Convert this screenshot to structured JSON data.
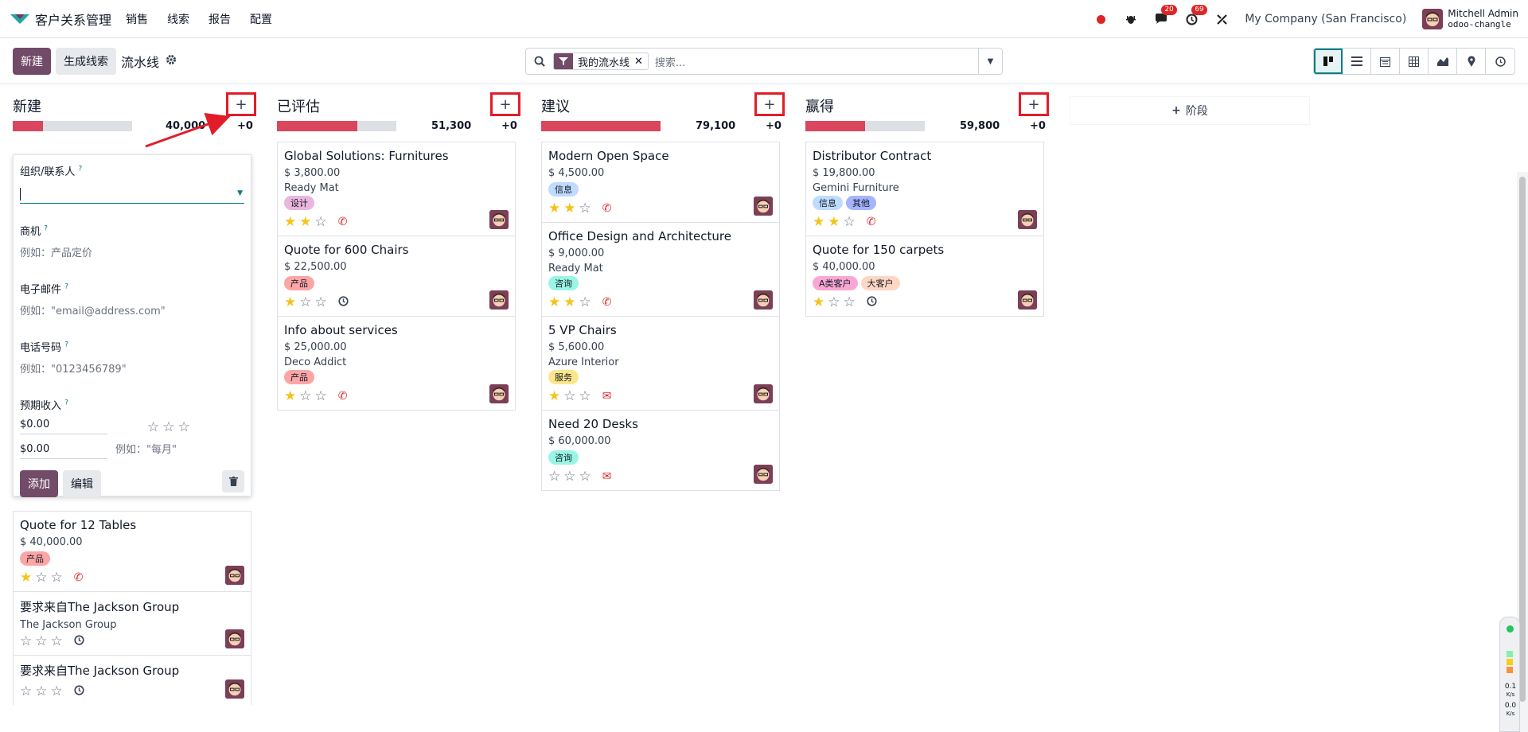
{
  "app": {
    "name": "客户关系管理"
  },
  "menu": [
    "销售",
    "线索",
    "报告",
    "配置"
  ],
  "systray": {
    "messages_count": "20",
    "activities_count": "69",
    "company": "My Company (San Francisco)",
    "user_name": "Mitchell Admin",
    "user_db": "odoo-changle"
  },
  "control": {
    "new_label": "新建",
    "generate_label": "生成线索",
    "breadcrumb": "流水线",
    "facet": "我的流水线",
    "search_placeholder": "搜索..."
  },
  "columns": [
    {
      "title": "新建",
      "total": "40,000",
      "plus": "+0",
      "progress": 0.25
    },
    {
      "title": "已评估",
      "total": "51,300",
      "plus": "+0",
      "progress": 0.67
    },
    {
      "title": "建议",
      "total": "79,100",
      "plus": "+0",
      "progress": 1.0
    },
    {
      "title": "嬴得",
      "total": "59,800",
      "plus": "+0",
      "progress": 0.5
    }
  ],
  "quick_create": {
    "contact_label": "组织/联系人",
    "opportunity_label": "商机",
    "opportunity_placeholder": "例如：产品定价",
    "email_label": "电子邮件",
    "email_placeholder": "例如：\"email@address.com\"",
    "phone_label": "电话号码",
    "phone_placeholder": "例如：\"0123456789\"",
    "revenue_label": "预期收入",
    "revenue_value": "$0.00",
    "recurring_value": "$0.00",
    "recurring_hint": "例如：\"每月\"",
    "add_label": "添加",
    "edit_label": "编辑",
    "help_mark": "?"
  },
  "cards_new": [
    {
      "title": "Quote for 12 Tables",
      "amount": "$ 40,000.00",
      "company": "",
      "tags": [
        {
          "label": "产品",
          "color": "#fca5a5"
        }
      ],
      "stars": 1,
      "activity": "phone"
    },
    {
      "title": "要求来自The Jackson Group",
      "amount": "",
      "company": "The Jackson Group",
      "tags": [],
      "stars": 0,
      "activity": "clock"
    },
    {
      "title": "要求来自The Jackson Group",
      "amount": "",
      "company": "",
      "tags": [],
      "stars": 0,
      "activity": "clock"
    }
  ],
  "cards_qualified": [
    {
      "title": "Global Solutions: Furnitures",
      "amount": "$ 3,800.00",
      "company": "Ready Mat",
      "tags": [
        {
          "label": "设计",
          "color": "#e9b7de"
        }
      ],
      "stars": 2,
      "activity": "phone"
    },
    {
      "title": "Quote for 600 Chairs",
      "amount": "$ 22,500.00",
      "company": "",
      "tags": [
        {
          "label": "产品",
          "color": "#fca5a5"
        }
      ],
      "stars": 1,
      "activity": "clock"
    },
    {
      "title": "Info about services",
      "amount": "$ 25,000.00",
      "company": "Deco Addict",
      "tags": [
        {
          "label": "产品",
          "color": "#fca5a5"
        }
      ],
      "stars": 1,
      "activity": "phone"
    }
  ],
  "cards_proposition": [
    {
      "title": "Modern Open Space",
      "amount": "$ 4,500.00",
      "company": "",
      "tags": [
        {
          "label": "信息",
          "color": "#bfdbfe"
        }
      ],
      "stars": 2,
      "activity": "phone"
    },
    {
      "title": "Office Design and Architecture",
      "amount": "$ 9,000.00",
      "company": "Ready Mat",
      "tags": [
        {
          "label": "咨询",
          "color": "#99f6e4"
        }
      ],
      "stars": 2,
      "activity": "phone"
    },
    {
      "title": "5 VP Chairs",
      "amount": "$ 5,600.00",
      "company": "Azure Interior",
      "tags": [
        {
          "label": "服务",
          "color": "#fde68a"
        }
      ],
      "stars": 1,
      "activity": "mail"
    },
    {
      "title": "Need 20 Desks",
      "amount": "$ 60,000.00",
      "company": "",
      "tags": [
        {
          "label": "咨询",
          "color": "#99f6e4"
        }
      ],
      "stars": 0,
      "activity": "mail"
    }
  ],
  "cards_won": [
    {
      "title": "Distributor Contract",
      "amount": "$ 19,800.00",
      "company": "Gemini Furniture",
      "tags": [
        {
          "label": "信息",
          "color": "#bfdbfe"
        },
        {
          "label": "其他",
          "color": "#a5b4fc"
        }
      ],
      "stars": 2,
      "activity": "phone"
    },
    {
      "title": "Quote for 150 carpets",
      "amount": "$ 40,000.00",
      "company": "",
      "tags": [
        {
          "label": "A类客户",
          "color": "#f9a8d4"
        },
        {
          "label": "大客户",
          "color": "#fed7c3"
        }
      ],
      "stars": 1,
      "activity": "clock"
    }
  ],
  "stage_add_label": "阶段",
  "netmon": {
    "up": "0.1",
    "down": "0.0",
    "unit": "K/s"
  }
}
